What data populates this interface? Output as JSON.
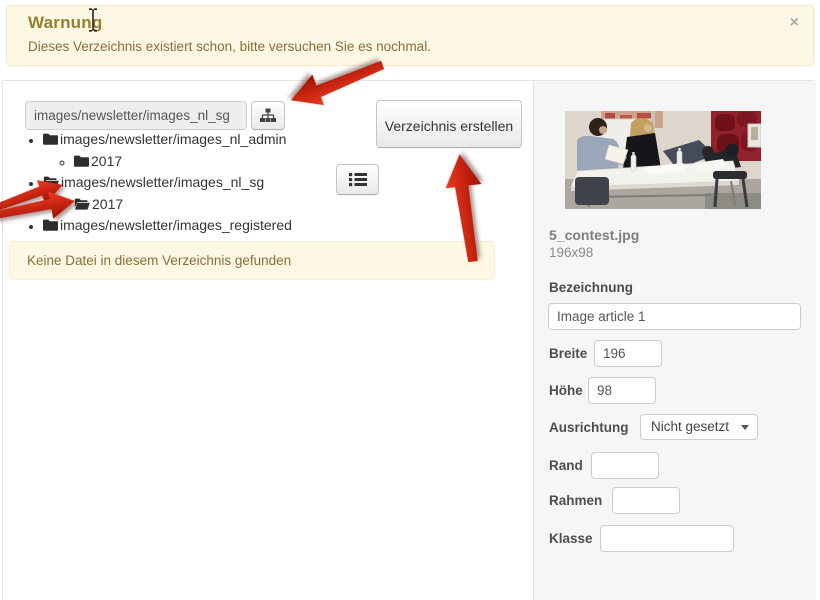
{
  "warning": {
    "title": "Warnung",
    "message": "Dieses Verzeichnis existiert schon, bitte versuchen Sie es nochmal.",
    "close_label": "×"
  },
  "explorer": {
    "path_input_value": "images/newsletter/images_nl_sg",
    "create_button_label": "Verzeichnis erstellen",
    "empty_message": "Keine Datei in diesem Verzeichnis gefunden",
    "tree": {
      "items": [
        {
          "label": "images/newsletter/images_nl_admin",
          "state": "closed"
        },
        {
          "label": "2017",
          "state": "closed"
        },
        {
          "label": "images/newsletter/images_nl_sg",
          "state": "open"
        },
        {
          "label": "2017",
          "state": "open"
        },
        {
          "label": "images/newsletter/images_registered",
          "state": "closed"
        }
      ]
    }
  },
  "preview": {
    "filename": "5_contest.jpg",
    "dimensions": "196x98"
  },
  "form": {
    "bezeichnung": {
      "label": "Bezeichnung",
      "value": "Image article 1"
    },
    "breite": {
      "label": "Breite",
      "value": "196"
    },
    "hoehe": {
      "label": "Höhe",
      "value": "98"
    },
    "ausrichtung": {
      "label": "Ausrichtung",
      "value": "Nicht gesetzt"
    },
    "rand": {
      "label": "Rand",
      "value": ""
    },
    "rahmen": {
      "label": "Rahmen",
      "value": ""
    },
    "klasse": {
      "label": "Klasse",
      "value": ""
    }
  },
  "colors": {
    "warning_bg": "#fcf8e3",
    "warning_text": "#8a6d3b",
    "arrow_red": "#d62c1a",
    "sidebar_bg": "#f6f6f6"
  }
}
